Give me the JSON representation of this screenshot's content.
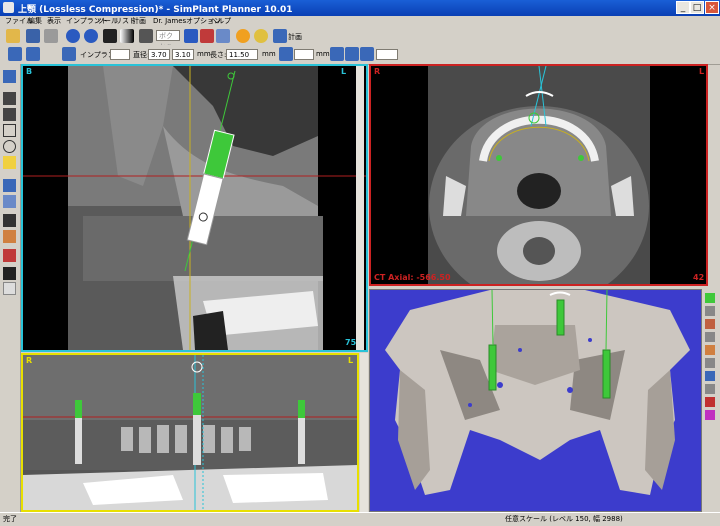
{
  "window": {
    "title": "上顎 (Lossless Compression)* - SimPlant Planner  10.01",
    "minimize": "_",
    "maximize": "□",
    "close": "×"
  },
  "menu": [
    "ファイル",
    "編集",
    "表示",
    "インプラント",
    "ツール",
    "リスト",
    "計画",
    "Dr. James",
    "オプション",
    "ヘルプ"
  ],
  "toolbar1": {
    "dropdown_value": "ボクセル",
    "plan_label": "計画"
  },
  "toolbar2": {
    "implant_label": "インプラント",
    "diameter_label": "直径:",
    "diameter_value": "3.70",
    "diameter_value2": "3.10",
    "diameter_unit": "mm",
    "length_label": "長さ:",
    "length_value": "11.50",
    "length_unit": "mm",
    "extra_unit": "mm"
  },
  "views": {
    "cross": {
      "left": "B",
      "right": "L",
      "number": "75"
    },
    "axial": {
      "left": "R",
      "right": "L",
      "footer": "CT Axial: -566.50",
      "number": "42"
    },
    "panoramic": {
      "left": "R",
      "right": "L"
    }
  },
  "status": {
    "left": "完了",
    "right": "任意スケール (レベル 150, 幅 2988)"
  },
  "colors": {
    "cross_border": "#29c3d8",
    "axial_border": "#cc2222",
    "pano_border": "#e8e000",
    "implant_green": "#3ec83a",
    "bg3d": "#3c3ccc"
  }
}
